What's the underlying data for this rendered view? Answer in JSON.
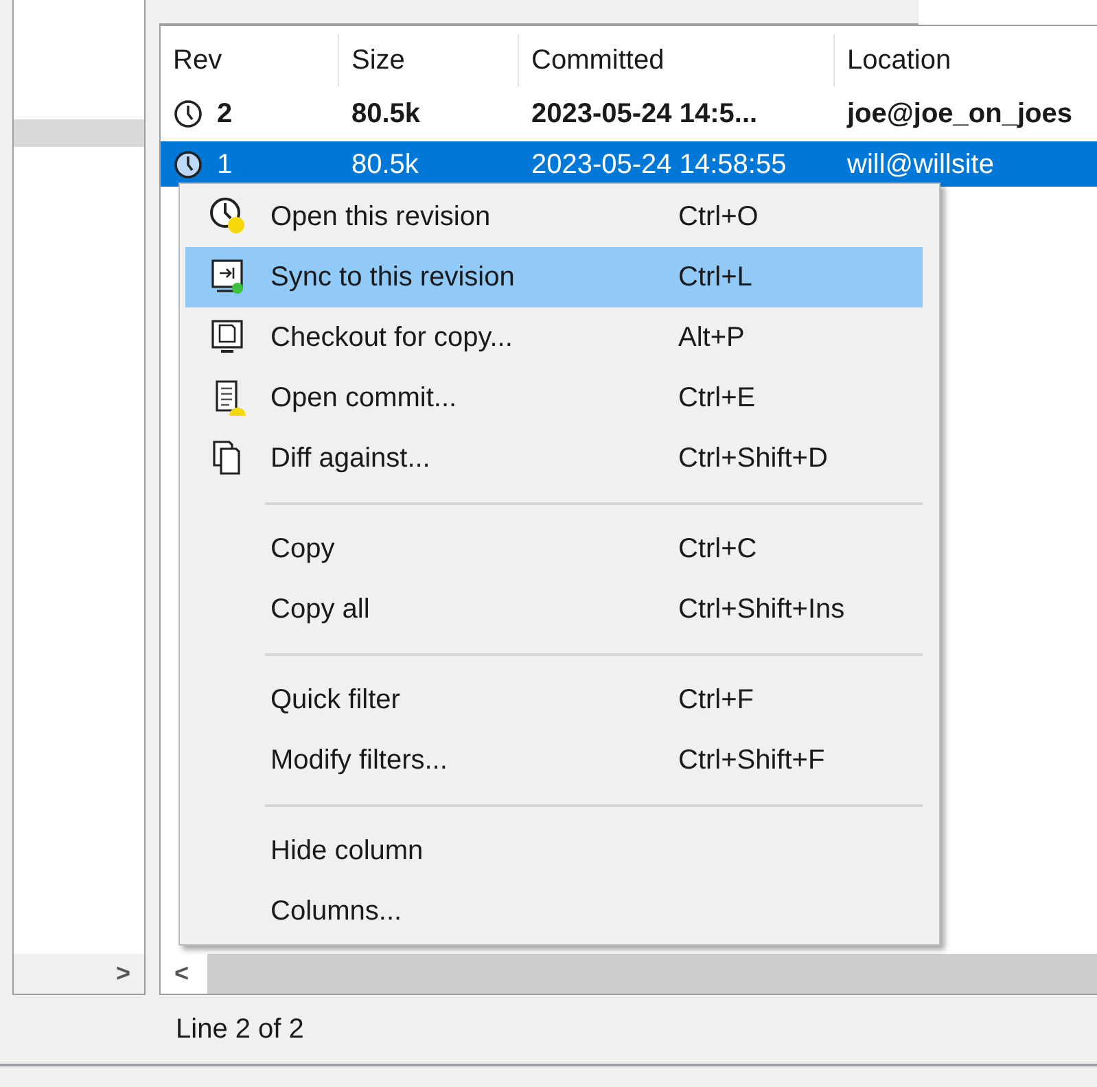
{
  "table": {
    "columns": [
      "Rev",
      "Size",
      "Committed",
      "Location"
    ],
    "rows": [
      {
        "cells": [
          "2",
          "80.5k",
          "2023-05-24 14:5...",
          "joe@joe_on_joes"
        ],
        "current": true,
        "selected": false
      },
      {
        "cells": [
          "1",
          "80.5k",
          "2023-05-24 14:58:55",
          "will@willsite"
        ],
        "current": false,
        "selected": true
      }
    ]
  },
  "context_menu": {
    "groups": [
      [
        {
          "label": "Open this revision",
          "shortcut": "Ctrl+O",
          "selected": false
        },
        {
          "label": "Sync to this revision",
          "shortcut": "Ctrl+L",
          "selected": true
        },
        {
          "label": "Checkout for copy...",
          "shortcut": "Alt+P",
          "selected": false
        },
        {
          "label": "Open commit...",
          "shortcut": "Ctrl+E",
          "selected": false
        },
        {
          "label": "Diff against...",
          "shortcut": "Ctrl+Shift+D",
          "selected": false
        }
      ],
      [
        {
          "label": "Copy",
          "shortcut": "Ctrl+C",
          "selected": false
        },
        {
          "label": "Copy all",
          "shortcut": "Ctrl+Shift+Ins",
          "selected": false
        }
      ],
      [
        {
          "label": "Quick filter",
          "shortcut": "Ctrl+F",
          "selected": false
        },
        {
          "label": "Modify filters...",
          "shortcut": "Ctrl+Shift+F",
          "selected": false
        }
      ],
      [
        {
          "label": "Hide column",
          "selected": false
        },
        {
          "label": "Columns...",
          "selected": false
        }
      ]
    ]
  },
  "left_scroll": {
    "arrow": ">"
  },
  "right_scroll": {
    "arrow": "<"
  },
  "status_bar": {
    "text": "Line 2 of 2"
  }
}
